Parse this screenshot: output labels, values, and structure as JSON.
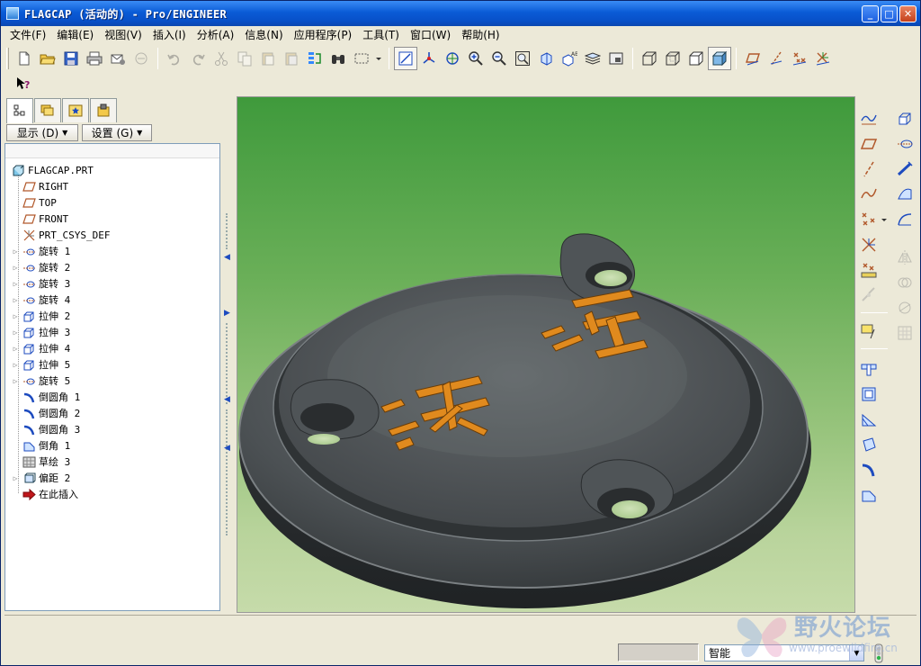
{
  "window": {
    "title": "FLAGCAP (活动的) - Pro/ENGINEER",
    "minimize_glyph": "_",
    "maximize_glyph": "□",
    "close_glyph": "✕"
  },
  "menu": [
    {
      "id": "file",
      "label": "文件(F)"
    },
    {
      "id": "edit",
      "label": "编辑(E)"
    },
    {
      "id": "view",
      "label": "视图(V)"
    },
    {
      "id": "insert",
      "label": "插入(I)"
    },
    {
      "id": "analysis",
      "label": "分析(A)"
    },
    {
      "id": "info",
      "label": "信息(N)"
    },
    {
      "id": "applications",
      "label": "应用程序(P)"
    },
    {
      "id": "tools",
      "label": "工具(T)"
    },
    {
      "id": "window",
      "label": "窗口(W)"
    },
    {
      "id": "help",
      "label": "帮助(H)"
    }
  ],
  "tree_panel": {
    "show_button": "显示 (D)",
    "settings_button": "设置 (G)",
    "items": [
      {
        "label": "FLAGCAP.PRT",
        "icon": "part-icon",
        "expandable": false
      },
      {
        "label": "RIGHT",
        "icon": "datum-plane-icon",
        "expandable": false
      },
      {
        "label": "TOP",
        "icon": "datum-plane-icon",
        "expandable": false
      },
      {
        "label": "FRONT",
        "icon": "datum-plane-icon",
        "expandable": false
      },
      {
        "label": "PRT_CSYS_DEF",
        "icon": "csys-icon",
        "expandable": false
      },
      {
        "label": "旋转 1",
        "icon": "revolve-icon",
        "expandable": true
      },
      {
        "label": "旋转 2",
        "icon": "revolve-icon",
        "expandable": true
      },
      {
        "label": "旋转 3",
        "icon": "revolve-icon",
        "expandable": true
      },
      {
        "label": "旋转 4",
        "icon": "revolve-icon",
        "expandable": true
      },
      {
        "label": "拉伸 2",
        "icon": "extrude-icon",
        "expandable": true
      },
      {
        "label": "拉伸 3",
        "icon": "extrude-icon",
        "expandable": true
      },
      {
        "label": "拉伸 4",
        "icon": "extrude-icon",
        "expandable": true
      },
      {
        "label": "拉伸 5",
        "icon": "extrude-icon",
        "expandable": true
      },
      {
        "label": "旋转 5",
        "icon": "revolve-icon",
        "expandable": true
      },
      {
        "label": "倒圆角 1",
        "icon": "round-icon",
        "expandable": false
      },
      {
        "label": "倒圆角 2",
        "icon": "round-icon",
        "expandable": false
      },
      {
        "label": "倒圆角 3",
        "icon": "round-icon",
        "expandable": false
      },
      {
        "label": "倒角 1",
        "icon": "chamfer-icon",
        "expandable": false
      },
      {
        "label": "草绘 3",
        "icon": "sketch-icon",
        "expandable": false
      },
      {
        "label": "偏距 2",
        "icon": "offset-icon",
        "expandable": true
      },
      {
        "label": "在此插入",
        "icon": "insert-here-icon",
        "expandable": false
      }
    ]
  },
  "status": {
    "filter_value": "智能"
  },
  "watermark": {
    "title": "野火论坛",
    "url": "www.proewildfire.cn"
  },
  "colors": {
    "titlebar": "#0a5bd6",
    "chrome": "#ece9d8",
    "viewport_top": "#3f9a3c",
    "viewport_bottom": "#c6dbaa",
    "part_body": "#4a4f52",
    "logo_fill": "#e08a1e"
  }
}
